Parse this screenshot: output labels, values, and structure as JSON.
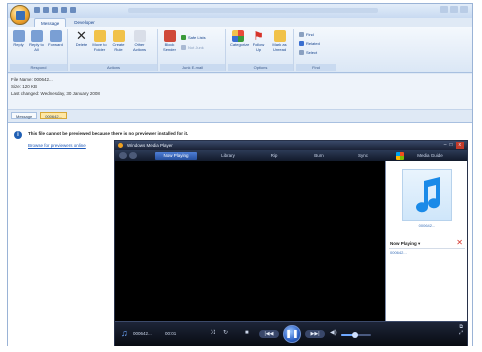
{
  "outlook": {
    "tabs": [
      "Message",
      "Developer"
    ],
    "ribbon": {
      "groups": {
        "respond": "Respond",
        "actions": "Actions",
        "junk": "Junk E-mail",
        "options": "Options",
        "find": "Find"
      },
      "buttons": {
        "reply": "Reply",
        "reply_all": "Reply to All",
        "forward": "Forward",
        "delete": "Delete",
        "move": "Move to Folder",
        "create_rule": "Create Rule",
        "other_actions": "Other Actions",
        "block_sender": "Block Sender",
        "safe_lists": "Safe Lists",
        "not_junk": "Not Junk",
        "categorize": "Categorize",
        "follow_up": "Follow Up",
        "mark_unread": "Mark as Unread",
        "find": "Find",
        "related": "Related",
        "select": "Select"
      }
    },
    "header": {
      "file_name_label": "File Name:",
      "file_name_value": "000642...",
      "size_label": "Size:",
      "size_value": "120 KB",
      "last_changed_label": "Last changed:",
      "last_changed_value": "Wednesday, 30 January 2008"
    },
    "attachments": {
      "message_tab": "Message",
      "file_tab": "000642..."
    },
    "preview": {
      "info_message": "This file cannot be previewed because there is no previewer installed for it.",
      "browse_link": "Browse for previewers online"
    }
  },
  "wmp": {
    "title": "Windows Media Player",
    "tabs": [
      "Now Playing",
      "Library",
      "Rip",
      "Burn",
      "Sync",
      "Media Guide"
    ],
    "active_tab": "Now Playing",
    "side": {
      "album_label": "000642...",
      "now_playing_label": "Now Playing",
      "playlist_item": "000642..."
    },
    "bottom": {
      "track_name": "000642...",
      "track_time": "00:01",
      "volume_level": 0.45
    }
  },
  "colors": {
    "ribbon_blue": "#dfe9f5",
    "wmp_accent": "#2e62c6",
    "link": "#1a56b8"
  }
}
